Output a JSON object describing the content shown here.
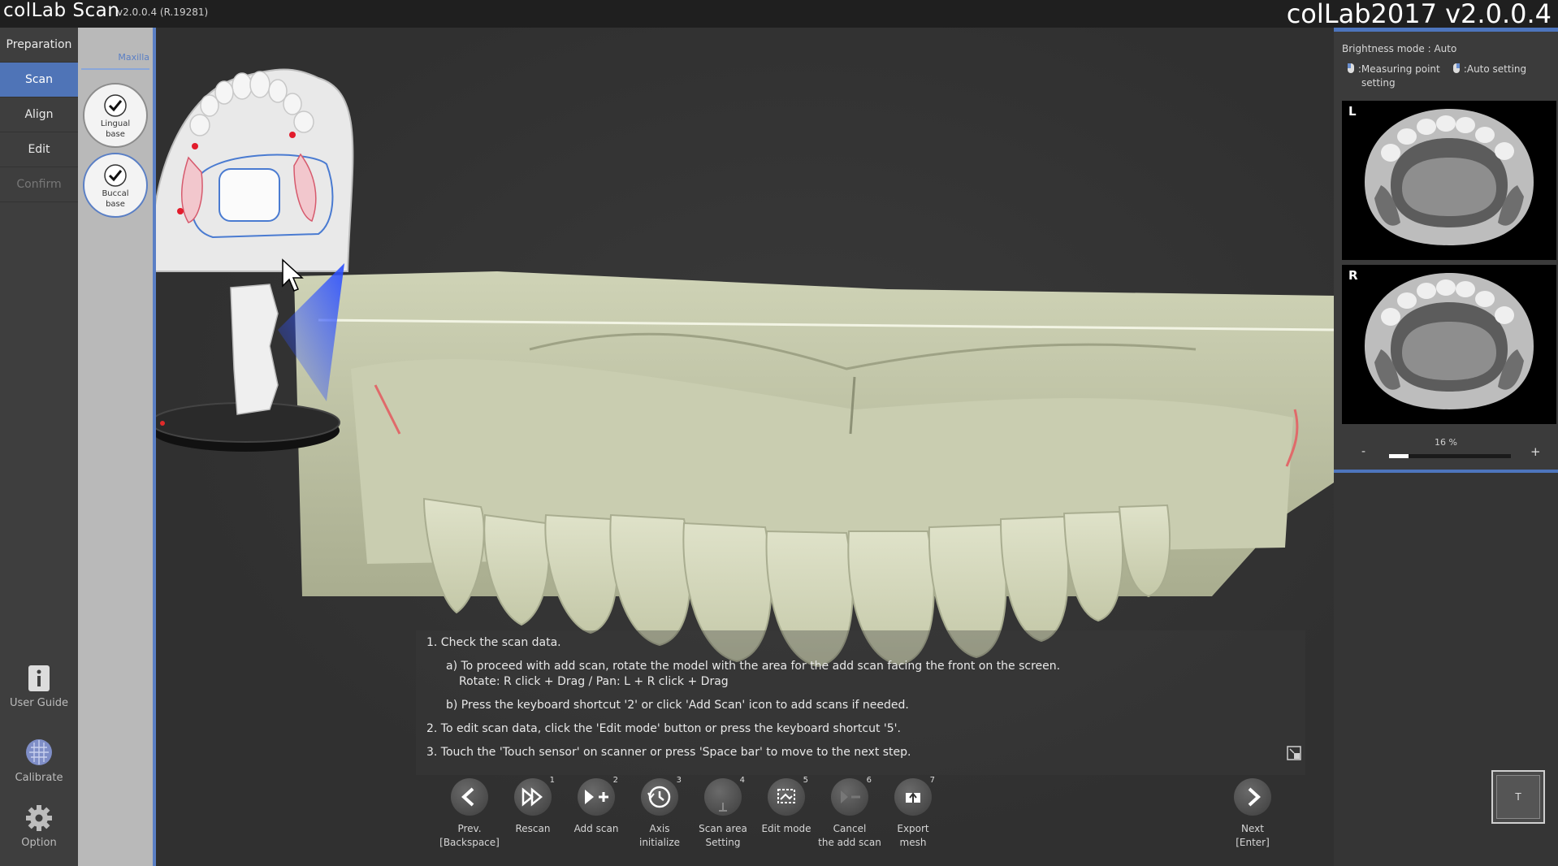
{
  "titlebar": {
    "app_name": "colLab Scan",
    "version": "v2.0.0.4  (R.19281)",
    "window_title": "colLab2017 v2.0.0.4"
  },
  "leftnav": {
    "items": [
      {
        "label": "Preparation",
        "state": "normal"
      },
      {
        "label": "Scan",
        "state": "active"
      },
      {
        "label": "Align",
        "state": "normal"
      },
      {
        "label": "Edit",
        "state": "normal"
      },
      {
        "label": "Confirm",
        "state": "disabled"
      }
    ],
    "bottom": {
      "user_guide": "User Guide",
      "calibrate": "Calibrate",
      "option": "Option"
    }
  },
  "steppanel": {
    "jaw": "Maxilla",
    "steps": [
      {
        "label_line1": "Lingual",
        "label_line2": "base"
      },
      {
        "label_line1": "Buccal",
        "label_line2": "base"
      }
    ]
  },
  "instructions": {
    "l1": "1. Check the scan data.",
    "l2": "a) To proceed with add scan, rotate the model with the area for the add scan facing the front on the screen.",
    "l3": "Rotate: R click + Drag / Pan: L + R click + Drag",
    "l4": "b) Press the keyboard shortcut '2' or click 'Add Scan' icon to add scans if needed.",
    "l5": "2. To edit scan data, click the 'Edit mode' button or press the keyboard shortcut '5'.",
    "l6": "3. Touch the 'Touch sensor' on scanner or press 'Space bar' to move to the next step."
  },
  "toolbar": {
    "prev": {
      "line1": "Prev.",
      "line2": "[Backspace]"
    },
    "rescan": {
      "num": "1",
      "line1": "Rescan",
      "line2": ""
    },
    "add_scan": {
      "num": "2",
      "line1": "Add scan",
      "line2": ""
    },
    "axis": {
      "num": "3",
      "line1": "Axis",
      "line2": "initialize"
    },
    "scan_area": {
      "num": "4",
      "line1": "Scan area",
      "line2": "Setting"
    },
    "edit_mode": {
      "num": "5",
      "line1": "Edit mode",
      "line2": ""
    },
    "cancel_add": {
      "num": "6",
      "line1": "Cancel",
      "line2": "the add scan"
    },
    "export": {
      "num": "7",
      "line1": "Export",
      "line2": "mesh"
    },
    "next": {
      "line1": "Next",
      "line2": "[Enter]"
    },
    "toggle_label": "T"
  },
  "rightpanel": {
    "brightness": "Brightness mode : Auto",
    "legend_measuring_1": ":Measuring point",
    "legend_measuring_2": "setting",
    "legend_auto": ":Auto setting",
    "left_label": "L",
    "right_label": "R",
    "zoom_text": "16 %",
    "zoom_value": 0.16,
    "zoom_minus": "-",
    "zoom_plus": "+"
  },
  "colors": {
    "accent": "#4f74b7",
    "model": "#d8dcc0"
  }
}
